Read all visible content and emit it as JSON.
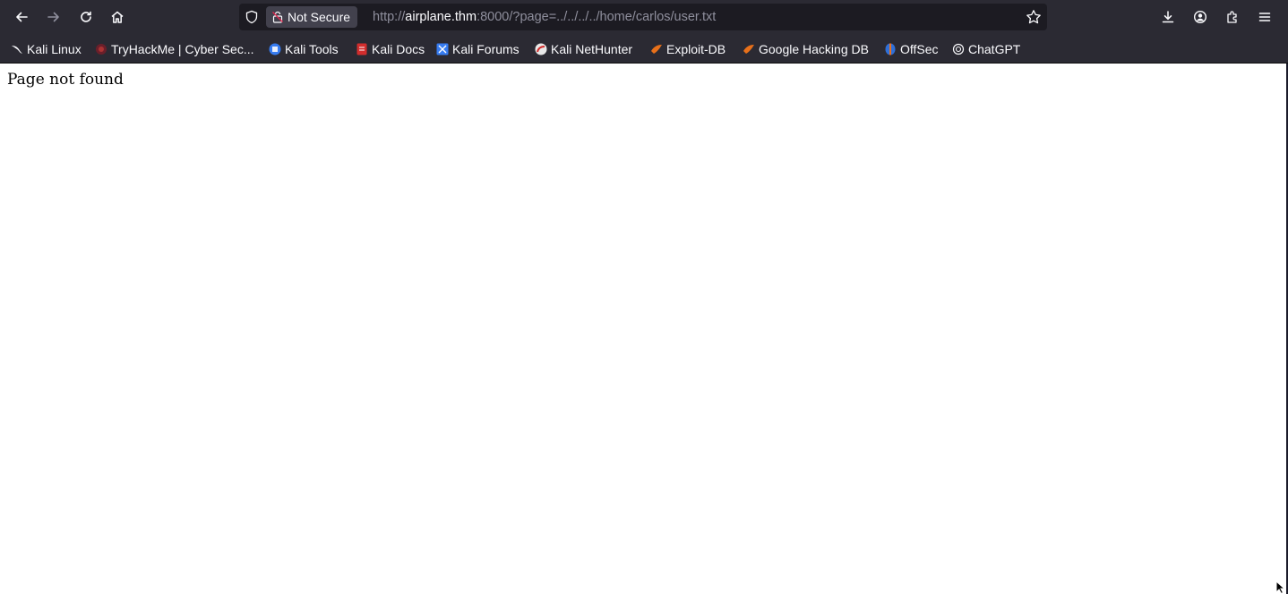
{
  "toolbar": {
    "back": "back-icon",
    "forward": "forward-icon",
    "reload": "reload-icon",
    "home": "home-icon"
  },
  "urlbar": {
    "security_label": "Not Secure",
    "url_prefix": "http://",
    "url_host": "airplane.thm",
    "url_rest": ":8000/?page=../../../../home/carlos/user.txt"
  },
  "bookmarks": [
    {
      "label": "Kali Linux",
      "icon": "kali-dragon-icon"
    },
    {
      "label": "TryHackMe | Cyber Sec...",
      "icon": "tryhackme-icon"
    },
    {
      "label": "Kali Tools",
      "icon": "kali-tools-icon"
    },
    {
      "label": "Kali Docs",
      "icon": "kali-docs-icon"
    },
    {
      "label": "Kali Forums",
      "icon": "kali-forums-icon"
    },
    {
      "label": "Kali NetHunter",
      "icon": "nethunter-icon"
    },
    {
      "label": "Exploit-DB",
      "icon": "exploitdb-icon"
    },
    {
      "label": "Google Hacking DB",
      "icon": "ghdb-icon"
    },
    {
      "label": "OffSec",
      "icon": "offsec-icon"
    },
    {
      "label": "ChatGPT",
      "icon": "chatgpt-icon"
    }
  ],
  "page": {
    "message": "Page not found"
  },
  "colors": {
    "toolbar_bg": "#2b2a33",
    "urlbar_bg": "#1c1b22",
    "chip_bg": "#42414d",
    "text_light": "#fbfbfe",
    "text_muted": "#8f8f9d"
  }
}
